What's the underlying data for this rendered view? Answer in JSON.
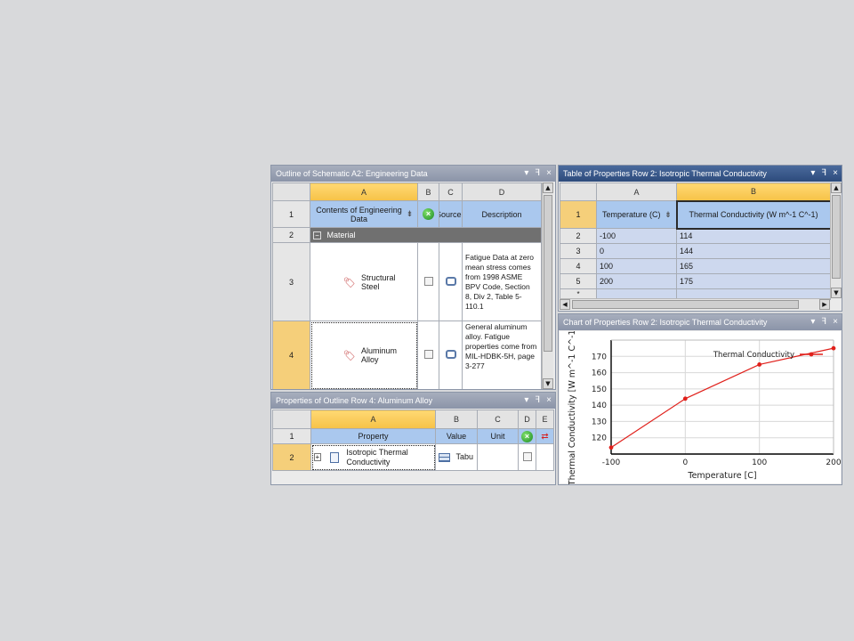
{
  "outline": {
    "title": "Outline of Schematic A2: Engineering Data",
    "buttons": [
      "▾",
      "ꟻ",
      "×"
    ],
    "columns": [
      "A",
      "B",
      "C",
      "D"
    ],
    "row_numbers": [
      "1",
      "2",
      "3",
      "4"
    ],
    "headers": {
      "contents": "Contents of Engineering Data",
      "source": "Source",
      "description": "Description"
    },
    "section_label": "Material",
    "rows": [
      {
        "name": "Structural Steel",
        "description": "Fatigue Data at zero mean stress comes from 1998 ASME BPV Code, Section 8, Div 2, Table 5-110.1"
      },
      {
        "name": "Aluminum Alloy",
        "description": "General aluminum alloy. Fatigue properties come from MIL-HDBK-5H, page 3-277"
      }
    ]
  },
  "properties": {
    "title": "Properties of Outline Row 4: Aluminum Alloy",
    "buttons": [
      "▾",
      "ꟻ",
      "×"
    ],
    "columns": [
      "A",
      "B",
      "C",
      "D",
      "E"
    ],
    "row_numbers": [
      "1",
      "2"
    ],
    "headers": {
      "property": "Property",
      "value": "Value",
      "unit": "Unit"
    },
    "row": {
      "property": "Isotropic Thermal Conductivity",
      "value": "Tabu"
    }
  },
  "table": {
    "title": "Table of Properties Row 2: Isotropic Thermal Conductivity",
    "buttons": [
      "▾",
      "ꟻ",
      "×"
    ],
    "columns": [
      "A",
      "B"
    ],
    "headers": {
      "temperature": "Temperature (C)",
      "conductivity": "Thermal Conductivity (W m^-1 C^-1)"
    },
    "row_numbers": [
      "1",
      "2",
      "3",
      "4",
      "5",
      "*"
    ],
    "rows": [
      {
        "temp": "-100",
        "value": "114"
      },
      {
        "temp": "0",
        "value": "144"
      },
      {
        "temp": "100",
        "value": "165"
      },
      {
        "temp": "200",
        "value": "175"
      }
    ]
  },
  "chart_panel": {
    "title": "Chart of Properties Row 2: Isotropic Thermal Conductivity",
    "buttons": [
      "▾",
      "ꟻ",
      "×"
    ]
  },
  "chart_data": {
    "type": "line",
    "x": [
      -100,
      0,
      100,
      200
    ],
    "series": [
      {
        "name": "Thermal Conductivity",
        "values": [
          114,
          144,
          165,
          175
        ],
        "color": "#e0201b"
      }
    ],
    "xlabel": "Temperature  [C]",
    "ylabel": "Thermal Conductivity  [W m^-1 C^-1]",
    "xlim": [
      -100,
      200
    ],
    "ylim": [
      110,
      180
    ],
    "xticks": [
      -100,
      0,
      100,
      200
    ],
    "yticks": [
      120,
      130,
      140,
      150,
      160,
      170
    ],
    "grid": true,
    "legend": "top-right"
  }
}
